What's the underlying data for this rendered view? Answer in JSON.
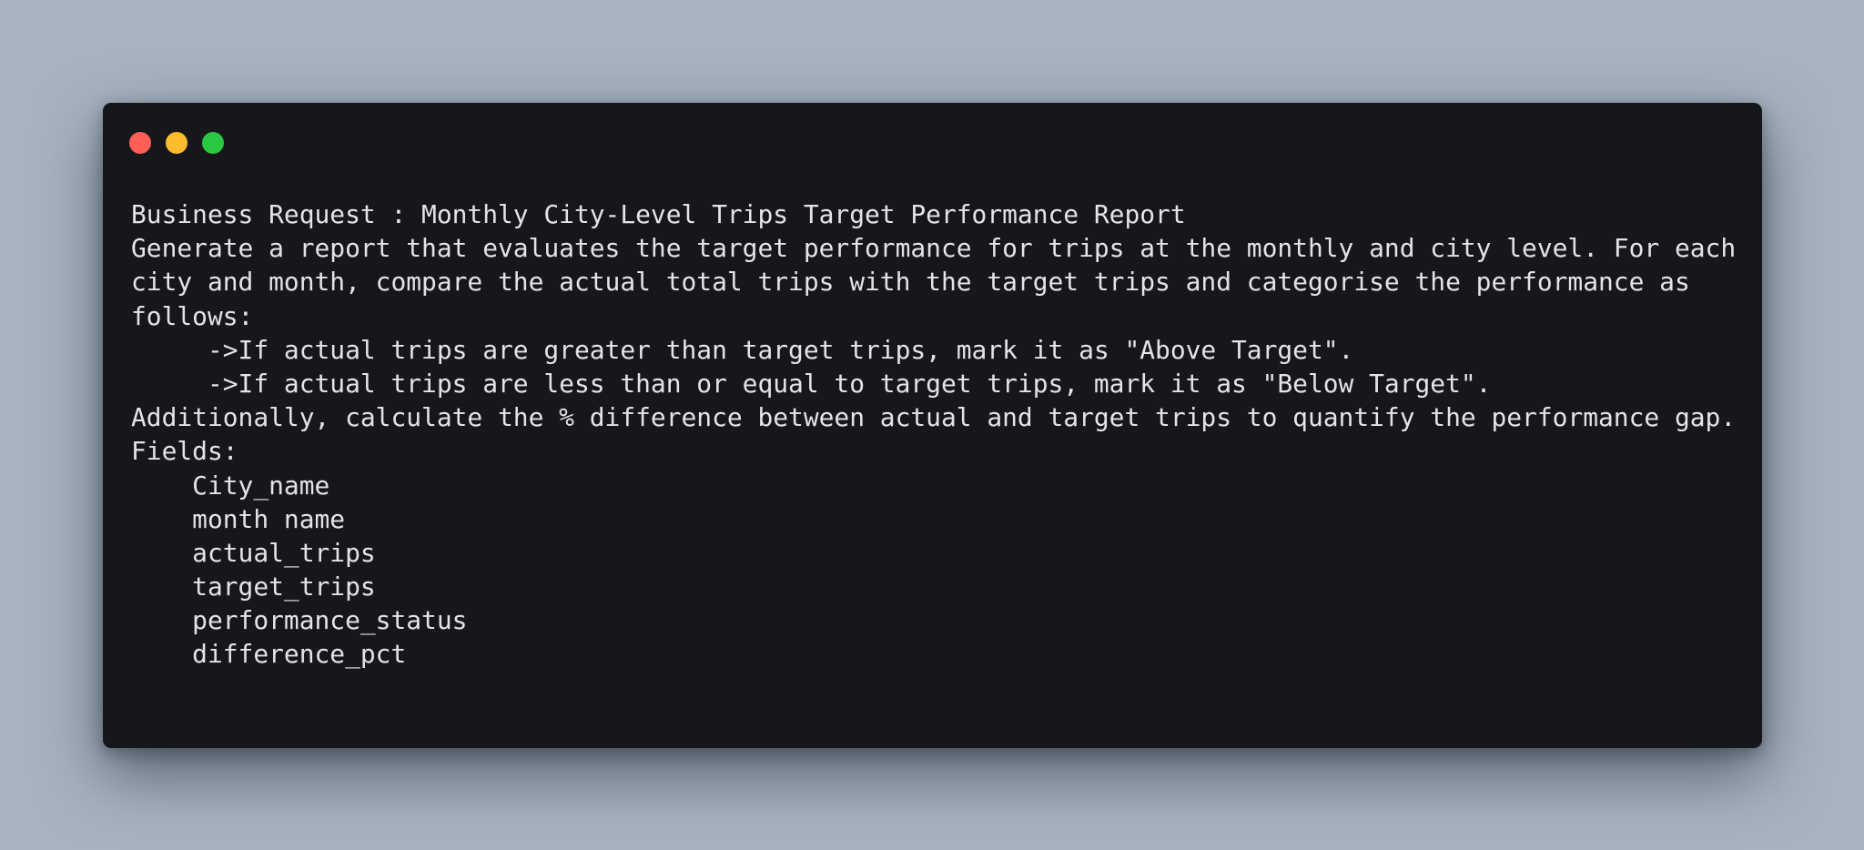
{
  "window": {
    "controls": [
      {
        "name": "close",
        "color": "#fe5f57"
      },
      {
        "name": "minimize",
        "color": "#febc2e"
      },
      {
        "name": "maximize",
        "color": "#28c840"
      }
    ]
  },
  "content": {
    "lines": [
      "Business Request : Monthly City-Level Trips Target Performance Report",
      "Generate a report that evaluates the target performance for trips at the monthly and city level. For each",
      "city and month, compare the actual total trips with the target trips and categorise the performance as",
      "follows:",
      "     ->If actual trips are greater than target trips, mark it as \"Above Target\".",
      "     ->If actual trips are less than or equal to target trips, mark it as \"Below Target\".",
      "Additionally, calculate the % difference between actual and target trips to quantify the performance gap.",
      "Fields:",
      "    City_name",
      "    month name",
      "    actual_trips",
      "    target_trips",
      "    performance_status",
      "    difference_pct"
    ]
  }
}
